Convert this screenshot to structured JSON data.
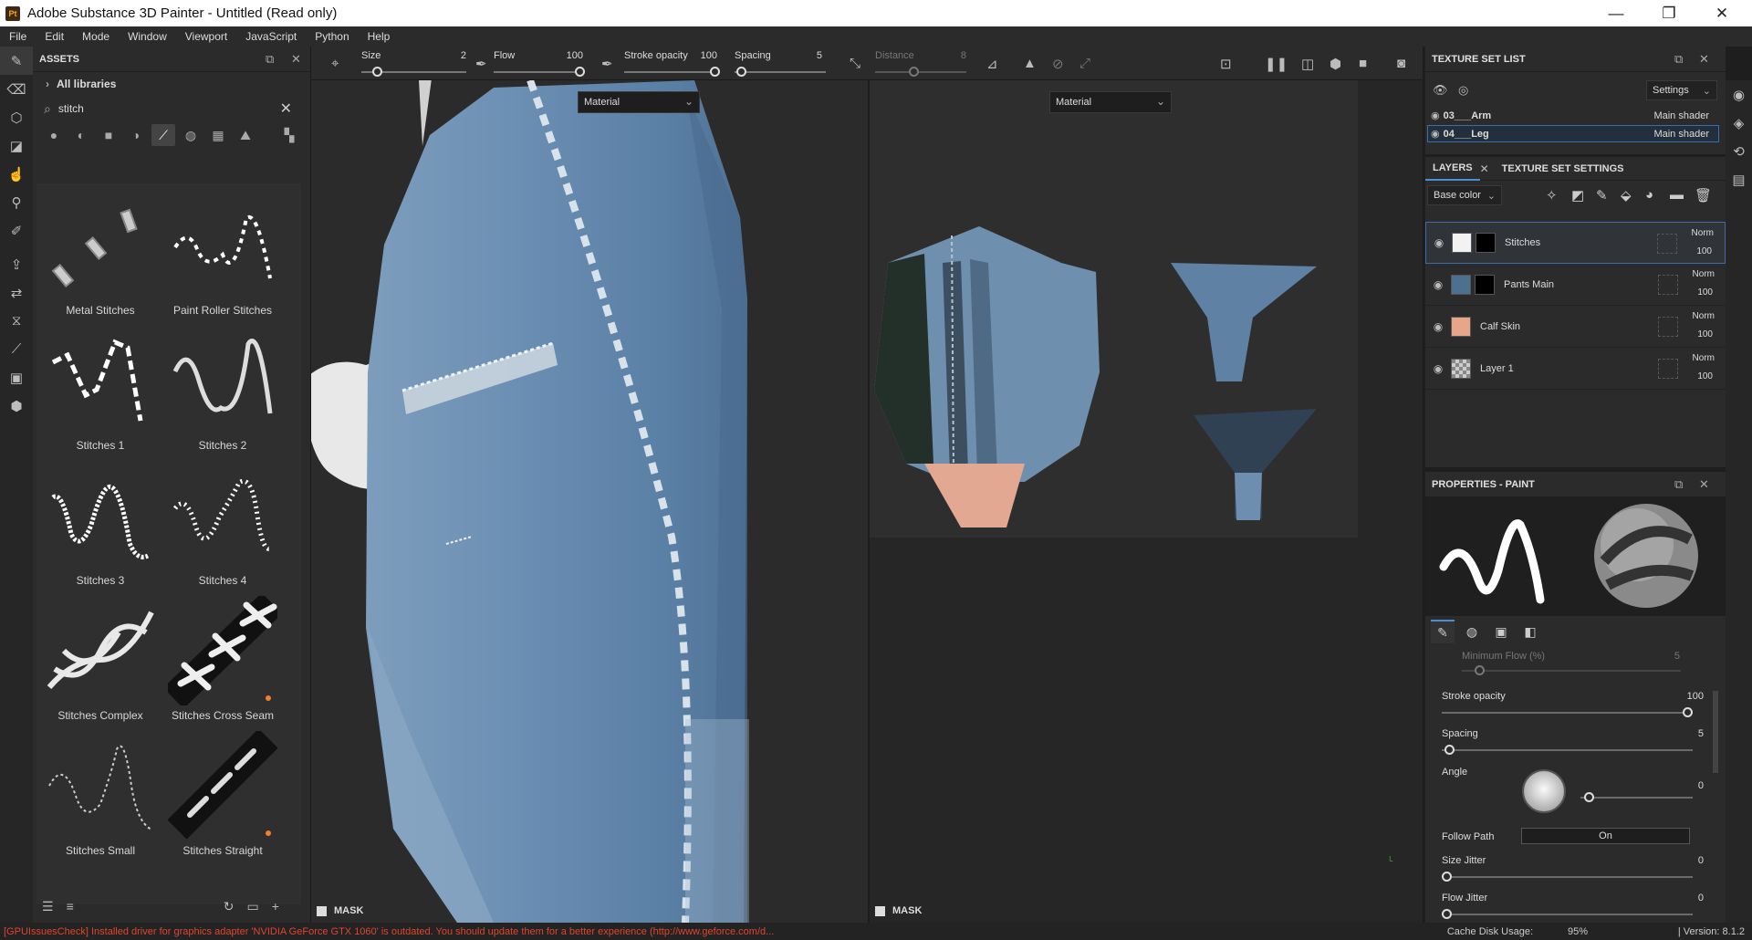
{
  "window": {
    "title": "Adobe Substance 3D Painter - Untitled (Read only)",
    "logo": "Pt"
  },
  "menu": [
    "File",
    "Edit",
    "Mode",
    "Window",
    "Viewport",
    "JavaScript",
    "Python",
    "Help"
  ],
  "assets": {
    "header": "ASSETS",
    "library": "All libraries",
    "search_value": "stitch",
    "items": [
      {
        "label": "Metal Stitches"
      },
      {
        "label": "Paint Roller Stitches"
      },
      {
        "label": "Stitches 1"
      },
      {
        "label": "Stitches 2"
      },
      {
        "label": "Stitches 3"
      },
      {
        "label": "Stitches 4"
      },
      {
        "label": "Stitches Complex"
      },
      {
        "label": "Stitches Cross Seam"
      },
      {
        "label": "Stitches Small"
      },
      {
        "label": "Stitches Straight"
      }
    ]
  },
  "toolbar": {
    "size": {
      "label": "Size",
      "value": "2"
    },
    "flow": {
      "label": "Flow",
      "value": "100"
    },
    "stroke_opacity": {
      "label": "Stroke opacity",
      "value": "100"
    },
    "spacing": {
      "label": "Spacing",
      "value": "5"
    },
    "distance": {
      "label": "Distance",
      "value": "8"
    }
  },
  "viewport3d": {
    "material_select": "Material",
    "mask_label": "MASK"
  },
  "viewport2d": {
    "material_select": "Material",
    "mask_label": "MASK"
  },
  "texture_set_list": {
    "header": "TEXTURE SET LIST",
    "settings": "Settings",
    "sets": [
      {
        "name": "03___Arm",
        "shader": "Main shader",
        "selected": false
      },
      {
        "name": "04___Leg",
        "shader": "Main shader",
        "selected": true
      }
    ]
  },
  "layers": {
    "tab_layers": "LAYERS",
    "tab_settings": "TEXTURE SET SETTINGS",
    "channel": "Base color",
    "items": [
      {
        "name": "Stitches",
        "blend": "Norm",
        "opacity": "100",
        "selected": true,
        "color": "#f2f2f2"
      },
      {
        "name": "Pants Main",
        "blend": "Norm",
        "opacity": "100",
        "selected": false,
        "color": "#4d6f90"
      },
      {
        "name": "Calf Skin",
        "blend": "Norm",
        "opacity": "100",
        "selected": false,
        "color": "#e9a58a"
      },
      {
        "name": "Layer 1",
        "blend": "Norm",
        "opacity": "100",
        "selected": false,
        "color": "#cccccc"
      }
    ]
  },
  "properties": {
    "header": "PROPERTIES - PAINT",
    "min_flow": {
      "label": "Minimum Flow (%)",
      "value": "5"
    },
    "stroke_opacity": {
      "label": "Stroke opacity",
      "value": "100"
    },
    "spacing": {
      "label": "Spacing",
      "value": "5"
    },
    "angle": {
      "label": "Angle",
      "value": "0"
    },
    "follow_path": {
      "label": "Follow Path",
      "value": "On"
    },
    "size_jitter": {
      "label": "Size Jitter",
      "value": "0"
    },
    "flow_jitter": {
      "label": "Flow Jitter",
      "value": "0"
    }
  },
  "status": {
    "message": "[GPUIssuesCheck] Installed driver for graphics adapter 'NVIDIA GeForce GTX 1060' is outdated. You should update them for a better experience (http://www.geforce.com/d...",
    "cache_label": "Cache Disk Usage:",
    "cache_value": "95%",
    "version": "| Version: 8.1.2"
  },
  "colors": {
    "accent": "#4a8fd4",
    "error": "#e0452e",
    "denim": "#4d7399"
  }
}
